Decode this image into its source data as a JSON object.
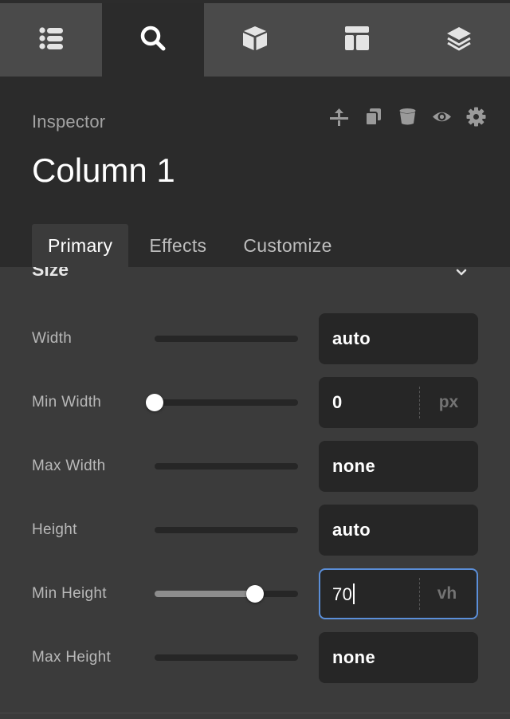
{
  "topbar": {
    "tabs": [
      {
        "icon": "list-icon",
        "active": false
      },
      {
        "icon": "search-icon",
        "active": true
      },
      {
        "icon": "cube-icon",
        "active": false
      },
      {
        "icon": "layout-icon",
        "active": false
      },
      {
        "icon": "layers-icon",
        "active": false
      }
    ]
  },
  "inspector": {
    "label": "Inspector",
    "title": "Column 1",
    "actions": [
      "move-up-icon",
      "duplicate-icon",
      "delete-icon",
      "visibility-icon",
      "settings-icon"
    ],
    "tabs": [
      {
        "label": "Primary",
        "active": true
      },
      {
        "label": "Effects",
        "active": false
      },
      {
        "label": "Customize",
        "active": false
      }
    ]
  },
  "section": {
    "title": "Size"
  },
  "fields": [
    {
      "label": "Width",
      "value": "auto",
      "unit": "",
      "slider_value": null,
      "focused": false
    },
    {
      "label": "Min Width",
      "value": "0",
      "unit": "px",
      "slider_value": 0,
      "focused": false
    },
    {
      "label": "Max Width",
      "value": "none",
      "unit": "",
      "slider_value": null,
      "focused": false
    },
    {
      "label": "Height",
      "value": "auto",
      "unit": "",
      "slider_value": null,
      "focused": false
    },
    {
      "label": "Min Height",
      "value": "70",
      "unit": "vh",
      "slider_value": 0.7,
      "focused": true
    },
    {
      "label": "Max Height",
      "value": "none",
      "unit": "",
      "slider_value": null,
      "focused": false
    }
  ],
  "colors": {
    "panel_bg": "#3b3b3b",
    "header_bg": "#2b2b2b",
    "topbar_bg": "#4a4a4a",
    "focus_border": "#5b8fd9"
  }
}
